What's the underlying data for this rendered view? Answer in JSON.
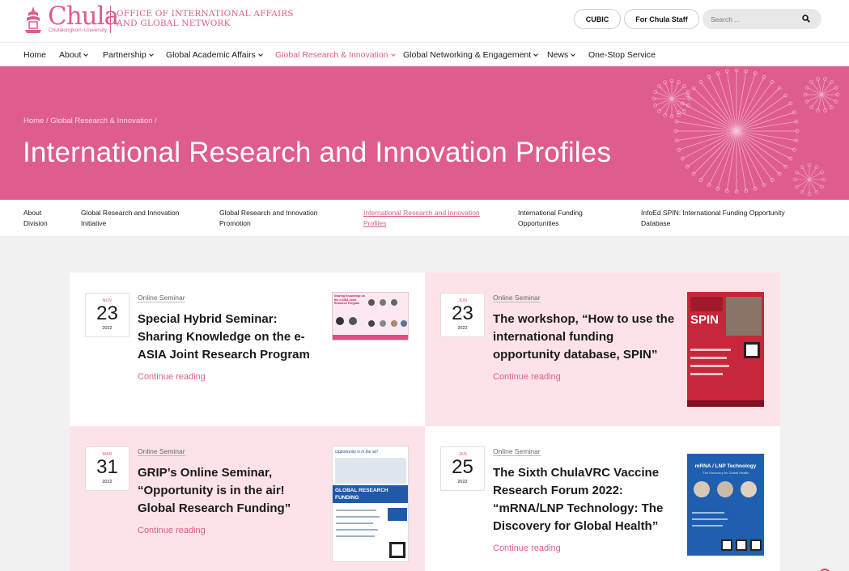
{
  "header": {
    "logo_word": "Chula",
    "logo_sub": "Chulalongkorn University",
    "office_line1": "OFFICE OF INTERNATIONAL AFFAIRS",
    "office_line2": "AND GLOBAL NETWORK",
    "cubic_label": "CUBIC",
    "staff_label": "For Chula Staff",
    "search_placeholder": "Search ...",
    "search_icon": "search-icon"
  },
  "nav": {
    "home": "Home",
    "about": "About",
    "partnership": "Partnership",
    "academic": "Global Academic Affairs",
    "research": "Global Research & Innovation",
    "networking": "Global Networking & Engagement",
    "news": "News",
    "onestop": "One-Stop Service"
  },
  "hero": {
    "breadcrumb": "Home / Global Research & Innovation /",
    "title": "International Research and Innovation Profiles"
  },
  "subnav": {
    "about_l1": "About",
    "about_l2": "Division",
    "initiative_l1": "Global Research and Innovation",
    "initiative_l2": "Initiative",
    "promotion_l1": "Global Research and Innovation",
    "promotion_l2": "Promotion",
    "profiles_l1": "International Research and Innovation",
    "profiles_l2": "Profiles",
    "funding_l1": "International Funding",
    "funding_l2": "Opportunities",
    "infoed_l1": "InfoEd SPIN: International Funding Opportunity",
    "infoed_l2": "Database"
  },
  "colors": {
    "brand_pink": "#df5c8e",
    "card_pink": "#fde3e7",
    "page_bg": "#f1f1f1"
  },
  "posts": [
    {
      "month": "NOV",
      "day": "23",
      "year": "2022",
      "category": "Online Seminar",
      "title": "Special Hybrid Seminar: Sharing Knowledge on the e-ASIA Joint Research Program",
      "continue": "Continue reading",
      "thumb_text": "Sharing Knowledge on the e-ASIA Joint Research Program"
    },
    {
      "month": "JUN",
      "day": "23",
      "year": "2022",
      "category": "Online Seminar",
      "title": "The workshop, “How to use the international funding opportunity database, SPIN”",
      "continue": "Continue reading",
      "thumb_text": "SPIN"
    },
    {
      "month": "MAR",
      "day": "31",
      "year": "2022",
      "category": "Online Seminar",
      "title": "GRIP’s Online Seminar, “Opportunity is in the air! Global Research Funding”",
      "continue": "Continue reading",
      "thumb_text_1": "Opportunity is in the air!",
      "thumb_text_2": "GLOBAL RESEARCH FUNDING"
    },
    {
      "month": "JAN",
      "day": "25",
      "year": "2022",
      "category": "Online Seminar",
      "title": "The Sixth ChulaVRC Vaccine Research Forum 2022: “mRNA/LNP Technology: The Discovery for Global Health”",
      "continue": "Continue reading",
      "thumb_text_1": "mRNA / LNP Technology",
      "thumb_text_2": "The Discovery for Global Health"
    }
  ]
}
